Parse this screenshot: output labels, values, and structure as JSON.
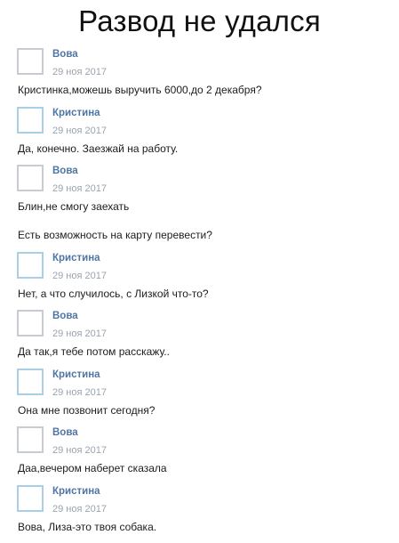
{
  "title": "Развод не удался",
  "colors": {
    "name": "#4f76a3",
    "date": "#9aa3ad",
    "avatar_vova_border": "#c7ccd2",
    "avatar_kristina_border": "#a9cfe6"
  },
  "messages": [
    {
      "author": "Вова",
      "date": "29 ноя 2017",
      "lines": [
        "Кристинка,можешь выручить 6000,до 2 декабря?"
      ]
    },
    {
      "author": "Кристина",
      "date": "29 ноя 2017",
      "lines": [
        "Да, конечно. Заезжай на работу."
      ]
    },
    {
      "author": "Вова",
      "date": "29 ноя 2017",
      "lines": [
        "Блин,не смогу заехать",
        "Есть возможность на карту перевести?"
      ]
    },
    {
      "author": "Кристина",
      "date": "29 ноя 2017",
      "lines": [
        "Нет, а что случилось, с Лизкой что-то?"
      ]
    },
    {
      "author": "Вова",
      "date": "29 ноя 2017",
      "lines": [
        "Да так,я тебе потом расскажу.."
      ]
    },
    {
      "author": "Кристина",
      "date": "29 ноя 2017",
      "lines": [
        "Она мне позвонит сегодня?"
      ]
    },
    {
      "author": "Вова",
      "date": "29 ноя 2017",
      "lines": [
        "Даа,вечером наберет сказала"
      ]
    },
    {
      "author": "Кристина",
      "date": "29 ноя 2017",
      "lines": [
        "Вова, Лиза-это твоя собака."
      ]
    }
  ]
}
